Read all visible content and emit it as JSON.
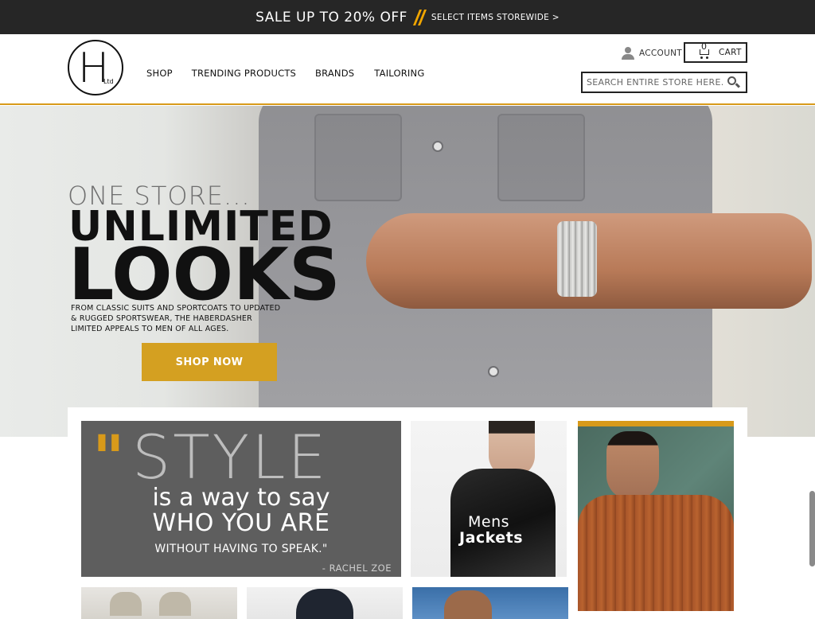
{
  "promo": {
    "main_text": "SALE UP TO 20% OFF",
    "sub_text": "SELECT ITEMS STOREWIDE >"
  },
  "header": {
    "logo_letter": "H",
    "logo_sub": "Ltd",
    "nav": [
      "SHOP",
      "TRENDING PRODUCTS",
      "BRANDS",
      "TAILORING"
    ],
    "account_label": "ACCOUNT",
    "cart_label": "CART",
    "cart_count": "0",
    "search_placeholder": "SEARCH ENTIRE STORE HERE..."
  },
  "hero": {
    "tagline": "ONE STORE...",
    "line1": "UNLIMITED",
    "line2": "LOOKS",
    "description": "FROM CLASSIC SUITS AND SPORTCOATS TO UPDATED & RUGGED SPORTSWEAR, THE HABERDASHER LIMITED APPEALS TO MEN OF ALL AGES.",
    "cta": "SHOP NOW"
  },
  "quote": {
    "big_word": "STYLE",
    "line2": "is a way to say",
    "line3": "WHO YOU ARE",
    "line4": "WITHOUT HAVING TO SPEAK.\"",
    "author": "- RACHEL ZOE"
  },
  "tiles": {
    "jackets_line1": "Mens",
    "jackets_line2": "Jackets"
  },
  "colors": {
    "accent": "#d89a1a",
    "cta": "#d4a021",
    "promo_bg": "#262626",
    "quote_bg": "#5e5e5e"
  }
}
